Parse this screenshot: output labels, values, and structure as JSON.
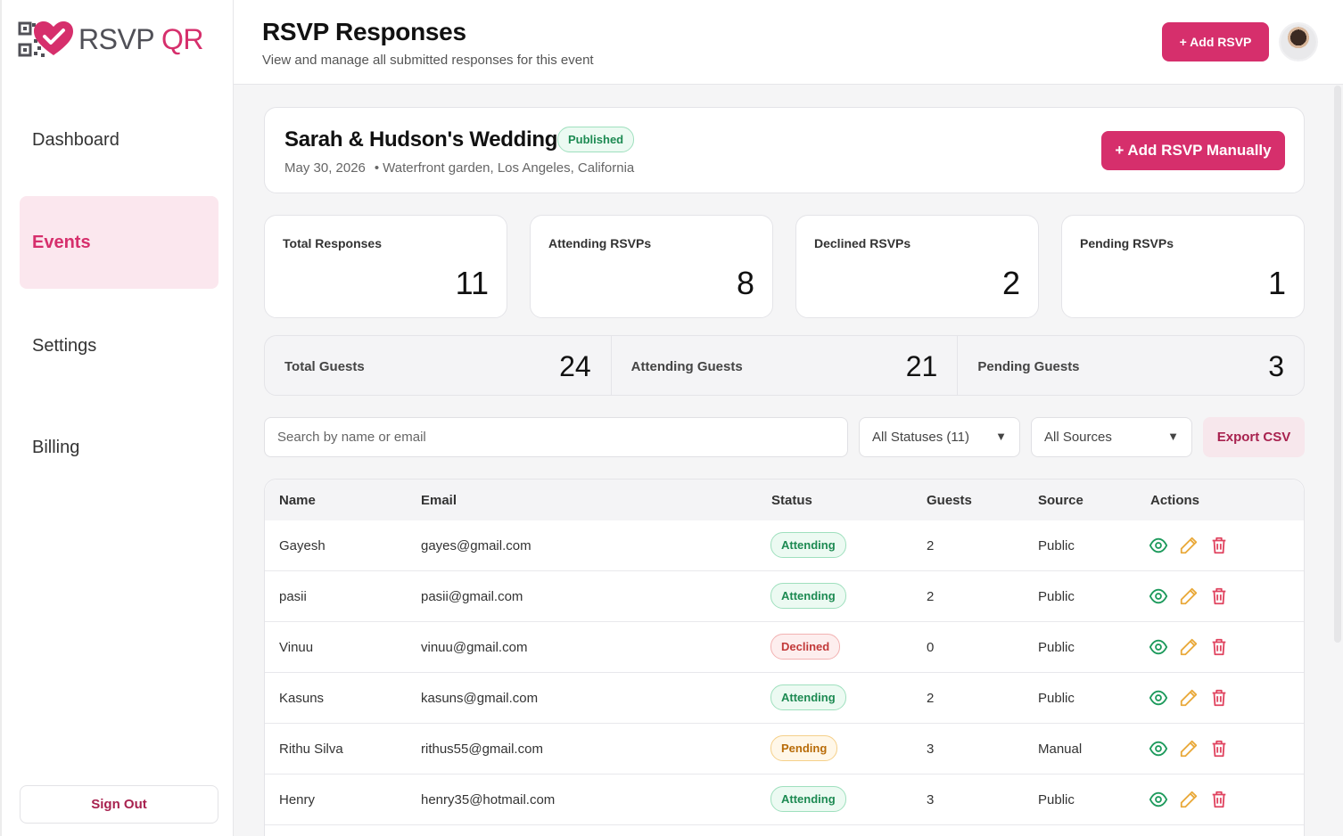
{
  "brand": {
    "part1": "RSVP",
    "part2": "QR"
  },
  "sidebar": {
    "items": [
      {
        "label": "Dashboard"
      },
      {
        "label": "Events"
      },
      {
        "label": "Settings"
      },
      {
        "label": "Billing"
      }
    ],
    "sign_out": "Sign Out"
  },
  "header": {
    "title": "RSVP Responses",
    "subtitle": "View and manage all submitted responses for this event",
    "add_button": "+ Add RSVP"
  },
  "event": {
    "name": "Sarah & Hudson's Wedding",
    "status": "Published",
    "date": "May 30, 2026",
    "location": "Waterfront garden, Los Angeles, California",
    "add_manual": "+ Add RSVP Manually"
  },
  "stats": [
    {
      "label": "Total Responses",
      "value": "11"
    },
    {
      "label": "Attending RSVPs",
      "value": "8"
    },
    {
      "label": "Declined RSVPs",
      "value": "2"
    },
    {
      "label": "Pending RSVPs",
      "value": "1"
    }
  ],
  "guests": [
    {
      "label": "Total Guests",
      "value": "24"
    },
    {
      "label": "Attending Guests",
      "value": "21"
    },
    {
      "label": "Pending Guests",
      "value": "3"
    }
  ],
  "filters": {
    "search_placeholder": "Search by name or email",
    "status": "All Statuses (11)",
    "source": "All Sources",
    "export": "Export CSV"
  },
  "table": {
    "headers": [
      "Name",
      "Email",
      "Status",
      "Guests",
      "Source",
      "Actions"
    ],
    "rows": [
      {
        "name": "Gayesh",
        "email": "gayes@gmail.com",
        "status": "Attending",
        "guests": "2",
        "source": "Public"
      },
      {
        "name": "pasii",
        "email": "pasii@gmail.com",
        "status": "Attending",
        "guests": "2",
        "source": "Public"
      },
      {
        "name": "Vinuu",
        "email": "vinuu@gmail.com",
        "status": "Declined",
        "guests": "0",
        "source": "Public"
      },
      {
        "name": "Kasuns",
        "email": "kasuns@gmail.com",
        "status": "Attending",
        "guests": "2",
        "source": "Public"
      },
      {
        "name": "Rithu Silva",
        "email": "rithus55@gmail.com",
        "status": "Pending",
        "guests": "3",
        "source": "Manual"
      },
      {
        "name": "Henry",
        "email": "henry35@hotmail.com",
        "status": "Attending",
        "guests": "3",
        "source": "Public"
      }
    ]
  },
  "colors": {
    "accent": "#d62f6c",
    "attending": "#1d8a52",
    "declined": "#c23a3a",
    "pending": "#b86b07"
  }
}
